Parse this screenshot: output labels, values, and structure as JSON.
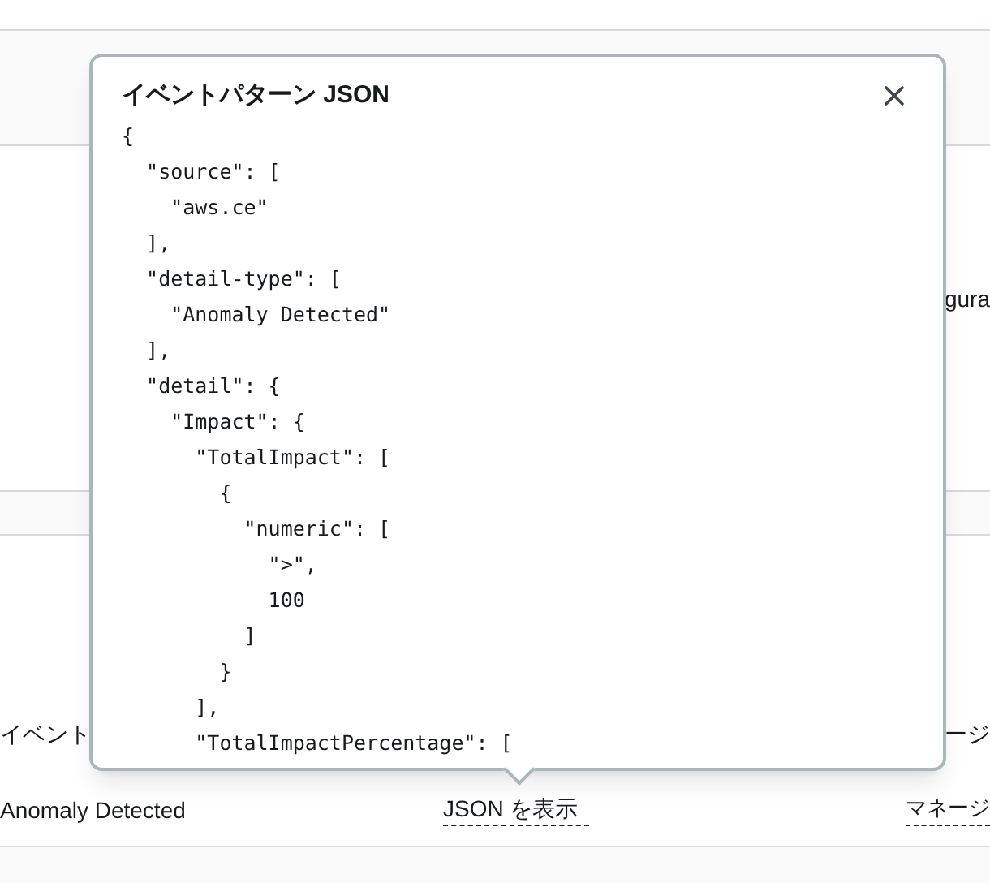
{
  "background": {
    "right_fragment": "gura",
    "row_label": "イベント",
    "row_label_right": "ージ",
    "detail_type": "Anomaly Detected",
    "json_link": "JSON を表示",
    "right_link": "マネージ"
  },
  "popover": {
    "title": "イベントパターン JSON",
    "lines": [
      "{",
      "  \"source\": [",
      "    \"aws.ce\"",
      "  ],",
      "  \"detail-type\": [",
      "    \"Anomaly Detected\"",
      "  ],",
      "  \"detail\": {",
      "    \"Impact\": {",
      "      \"TotalImpact\": [",
      "        {",
      "          \"numeric\": [",
      "            \">\",",
      "            100",
      "          ]",
      "        }",
      "      ],",
      "      \"TotalImpactPercentage\": ["
    ]
  }
}
